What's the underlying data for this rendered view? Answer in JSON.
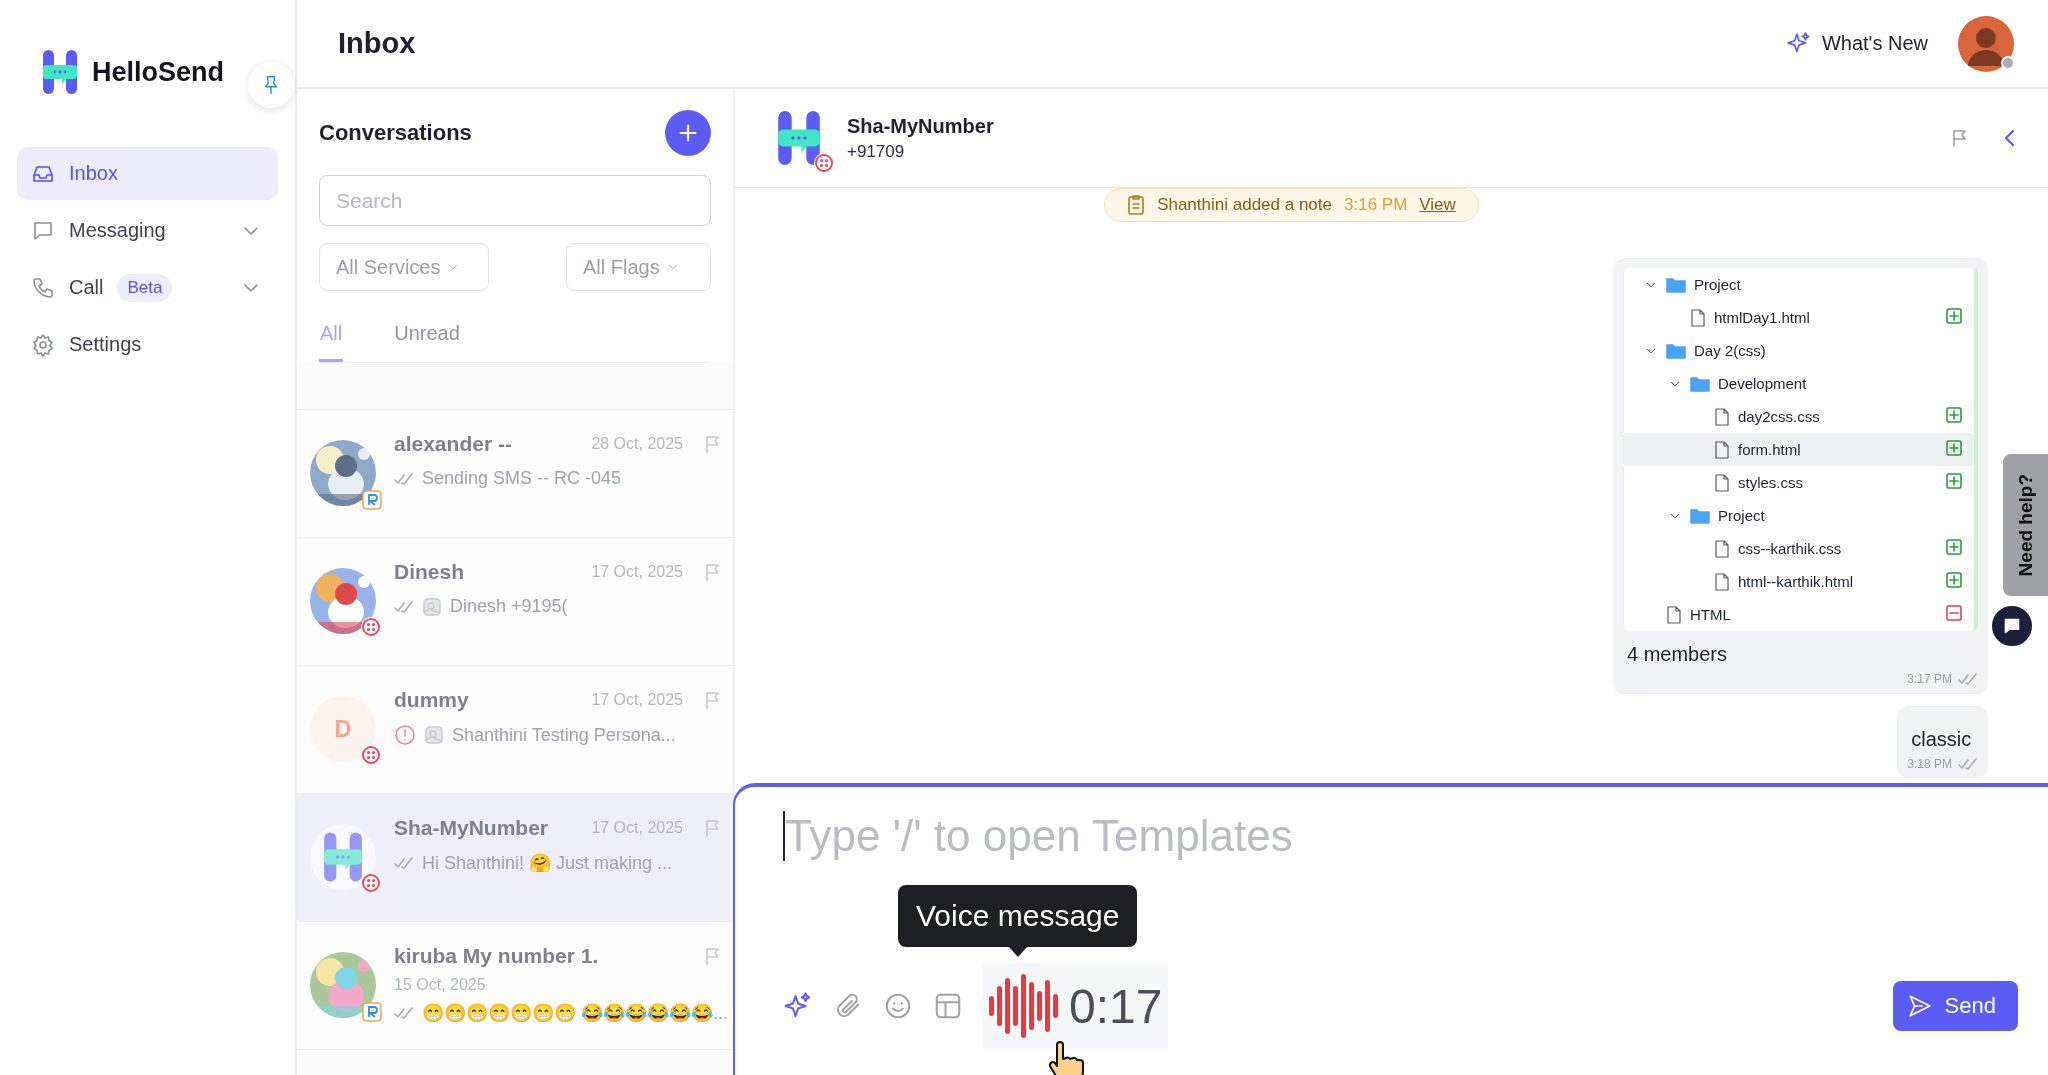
{
  "app": {
    "name": "HelloSend"
  },
  "sidebar": {
    "items": [
      {
        "label": "Inbox",
        "selected": true,
        "expandable": false
      },
      {
        "label": "Messaging",
        "selected": false,
        "expandable": true
      },
      {
        "label": "Call",
        "selected": false,
        "expandable": true,
        "badge": "Beta"
      },
      {
        "label": "Settings",
        "selected": false,
        "expandable": false
      }
    ]
  },
  "header": {
    "title": "Inbox",
    "whats_new": "What's New",
    "user": {
      "online": false
    }
  },
  "conversations": {
    "title": "Conversations",
    "search": {
      "placeholder": "Search"
    },
    "filters": [
      "All Services",
      "All Flags"
    ],
    "tabs": [
      {
        "label": "All",
        "selected": true
      },
      {
        "label": "Unread",
        "selected": false
      }
    ],
    "items": [
      {
        "name": "alexander --",
        "date": "28 Oct, 2025",
        "date_on_own_line": false,
        "preview": "Sending SMS -- RC -045",
        "kind": "picture",
        "failed": false,
        "attachment": false,
        "selected": false
      },
      {
        "name": "Dinesh",
        "date": "17 Oct, 2025",
        "date_on_own_line": false,
        "preview": "Dinesh +9195(",
        "kind": "picture",
        "failed": false,
        "attachment": true,
        "selected": false
      },
      {
        "name": "dummy",
        "date": "17 Oct, 2025",
        "date_on_own_line": false,
        "preview": "Shanthini Testing Persona...",
        "kind": "initial",
        "initial": "D",
        "failed": true,
        "attachment": true,
        "selected": false
      },
      {
        "name": "Sha-MyNumber",
        "date": "17 Oct, 2025",
        "date_on_own_line": false,
        "preview": "Hi Shanthini! 🤗 Just making ...",
        "kind": "logo",
        "failed": false,
        "attachment": false,
        "selected": true
      },
      {
        "name": "kiruba My number 1.",
        "date": "15 Oct, 2025",
        "date_on_own_line": true,
        "preview": "😁😁😁😁😁😁😁 😂😂😂😂😂😂...",
        "kind": "picture",
        "failed": false,
        "attachment": false,
        "selected": false
      }
    ]
  },
  "chat": {
    "contact": {
      "name": "Sha-MyNumber",
      "phone": "+91709"
    },
    "note": {
      "text": "Shanthini added a note",
      "time": "3:16 PM",
      "link": "View"
    },
    "messages": [
      {
        "kind": "tree",
        "text": "4 members",
        "time": "3:17 PM",
        "tree": [
          {
            "name": "Project",
            "kind": "folder",
            "expanded": true,
            "children": [
              {
                "name": "htmlDay1.html",
                "kind": "file",
                "added": true,
                "selected": false
              }
            ]
          },
          {
            "name": "Day 2(css)",
            "kind": "folder",
            "expanded": true,
            "children": [
              {
                "name": "Development",
                "kind": "folder",
                "expanded": true,
                "children": [
                  {
                    "name": "day2css.css",
                    "kind": "file",
                    "added": true,
                    "selected": false
                  },
                  {
                    "name": "form.html",
                    "kind": "file",
                    "added": true,
                    "selected": true
                  },
                  {
                    "name": "styles.css",
                    "kind": "file",
                    "added": true,
                    "selected": false
                  }
                ]
              },
              {
                "name": "Project",
                "kind": "folder",
                "expanded": true,
                "children": [
                  {
                    "name": "css--karthik.css",
                    "kind": "file",
                    "added": true,
                    "selected": false
                  },
                  {
                    "name": "html--karthik.html",
                    "kind": "file",
                    "added": true,
                    "selected": false
                  }
                ]
              }
            ]
          },
          {
            "name": "HTML",
            "kind": "file",
            "added": false,
            "selected": false
          }
        ]
      },
      {
        "kind": "text",
        "text": "classic",
        "time": "3:18 PM"
      }
    ],
    "composer": {
      "placeholder": "Type '/' to open Templates",
      "tooltip": "Voice message",
      "duration": "0:17",
      "send": "Send"
    },
    "help": {
      "label": "Need help?"
    }
  }
}
